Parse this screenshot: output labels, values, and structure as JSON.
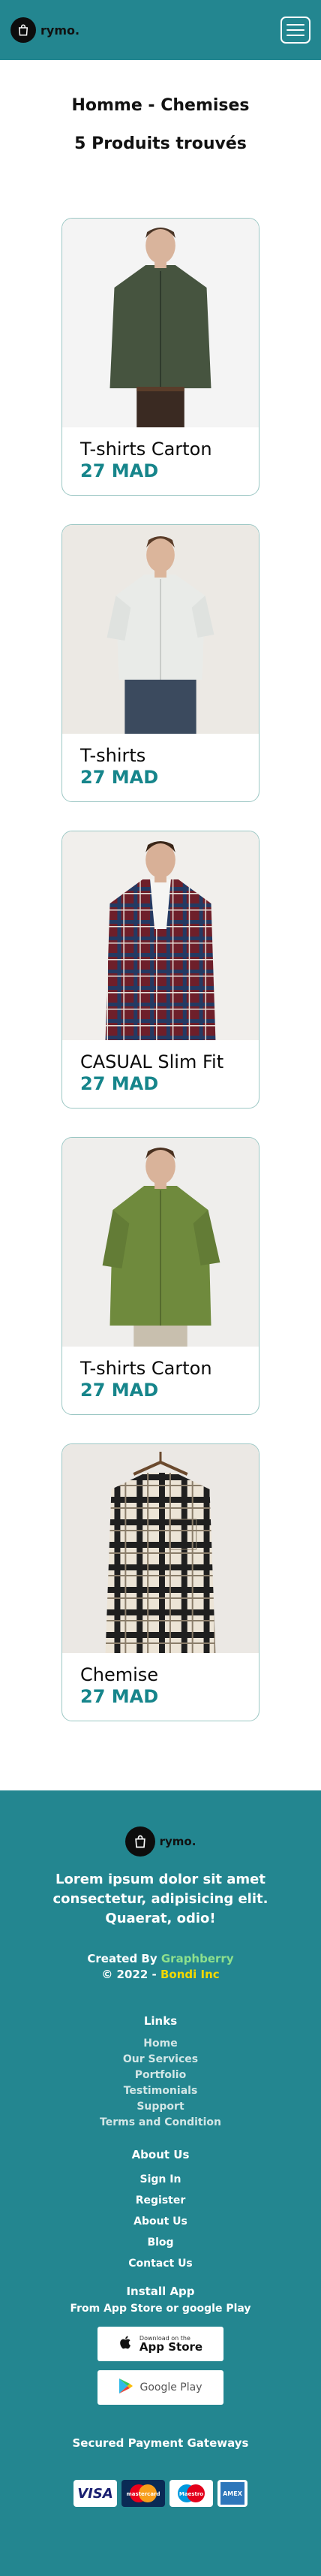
{
  "header": {
    "brand": "rymo.",
    "menu_icon": "hamburger-icon"
  },
  "page": {
    "title": "Homme - Chemises",
    "count": "5 Produits trouvés"
  },
  "products": [
    {
      "name": "T-shirts Carton",
      "price": "27 MAD",
      "image": "dark-green-shirt-photo"
    },
    {
      "name": "T-shirts",
      "price": "27 MAD",
      "image": "white-shirt-photo"
    },
    {
      "name": "CASUAL Slim Fit",
      "price": "27 MAD",
      "image": "plaid-shirt-photo"
    },
    {
      "name": "T-shirts Carton",
      "price": "27 MAD",
      "image": "olive-green-shirt-photo"
    },
    {
      "name": "Chemise",
      "price": "27 MAD",
      "image": "checked-shirt-on-hanger-photo"
    }
  ],
  "footer": {
    "brand": "rymo.",
    "tagline": "Lorem ipsum dolor sit amet consectetur, adipisicing elit. Quaerat, odio!",
    "created_prefix": "Created By",
    "created_by": "Graphberry",
    "copyright_prefix": "© 2022 -",
    "company": "Bondi Inc",
    "links_title": "Links",
    "links": [
      "Home",
      "Our Services",
      "Portfolio",
      "Testimonials",
      "Support",
      "Terms and Condition"
    ],
    "about_title": "About Us",
    "about_links": [
      "Sign In",
      "Register",
      "About Us",
      "Blog",
      "Contact Us"
    ],
    "install_title": "Install App",
    "install_sub": "From App Store or google Play",
    "appstore_small": "Download on the",
    "appstore_big": "App Store",
    "googleplay": "Google Play",
    "payments_title": "Secured Payment Gateways",
    "payments": [
      "VISA",
      "mastercard",
      "Maestro",
      "AMEX"
    ],
    "colors": {
      "teal": "#238690",
      "price": "#16858b",
      "link_green": "#8de08d",
      "link_yellow": "#f2d800"
    }
  }
}
